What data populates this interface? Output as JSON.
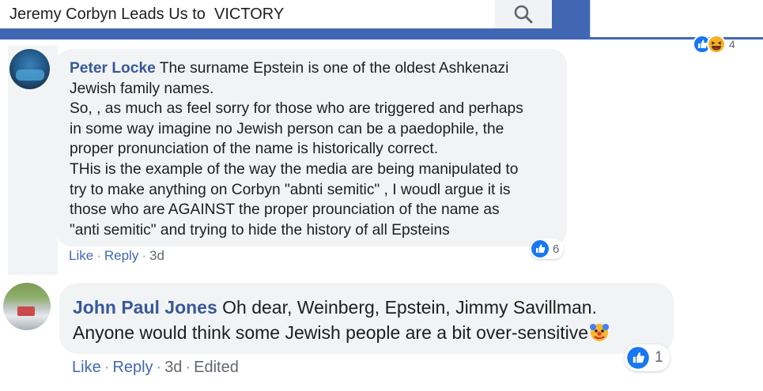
{
  "search": {
    "value": "Jeremy Corbyn Leads Us to  VICTORY"
  },
  "top_reactions": {
    "count": "4"
  },
  "comments": [
    {
      "author": "Peter Locke",
      "lines": [
        "The surname Epstein is one of the oldest Ashkenazi",
        "Jewish family names.",
        "So, , as much as feel sorry for those who are triggered and perhaps",
        "in some way imagine no Jewish person can be a paedophile, the",
        "proper pronunciation of the name is historically correct.",
        "THis is the example of the way the media are being manipulated to",
        "try to make anything on Corbyn \"abnti semitic\" , I woudl argue it is",
        "those who are AGAINST the proper prounciation of the name as",
        "\"anti semitic\" and trying to hide the history of all Epsteins"
      ],
      "like_label": "Like",
      "reply_label": "Reply",
      "time": "3d",
      "reaction_count": "6"
    },
    {
      "author": "John Paul Jones",
      "lines": [
        "Oh dear, Weinberg, Epstein, Jimmy Savillman.",
        "Anyone would think some Jewish people are a bit over-sensitive"
      ],
      "like_label": "Like",
      "reply_label": "Reply",
      "time": "3d",
      "edited_label": "Edited",
      "reaction_count": "1"
    }
  ],
  "colors": {
    "brand_blue": "#4267b2",
    "author_blue": "#385898",
    "bubble_grey": "#f2f3f5",
    "meta_grey": "#606770"
  },
  "icons": [
    "search-icon",
    "like-icon",
    "haha-icon",
    "clown-emoji-icon"
  ]
}
